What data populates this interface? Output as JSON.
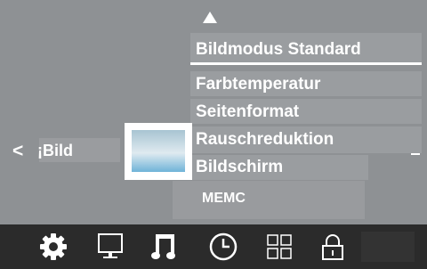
{
  "menu": {
    "title": "Bildmodus Standard",
    "items": [
      {
        "label": "Farbtemperatur"
      },
      {
        "label": "Seitenformat"
      },
      {
        "label": "Rauschreduktion"
      },
      {
        "label": "Bildschirm"
      }
    ]
  },
  "submenu": {
    "label": "MEMC"
  },
  "back": {
    "arrow": "<",
    "label": "¡Bild"
  },
  "bottom_bar": {
    "icons": [
      "gear-icon",
      "monitor-icon",
      "music-icon",
      "clock-icon",
      "grid-icon",
      "lock-icon"
    ]
  },
  "colors": {
    "background": "#8e9194",
    "bar": "#2b2b2b",
    "text": "#ffffff"
  }
}
